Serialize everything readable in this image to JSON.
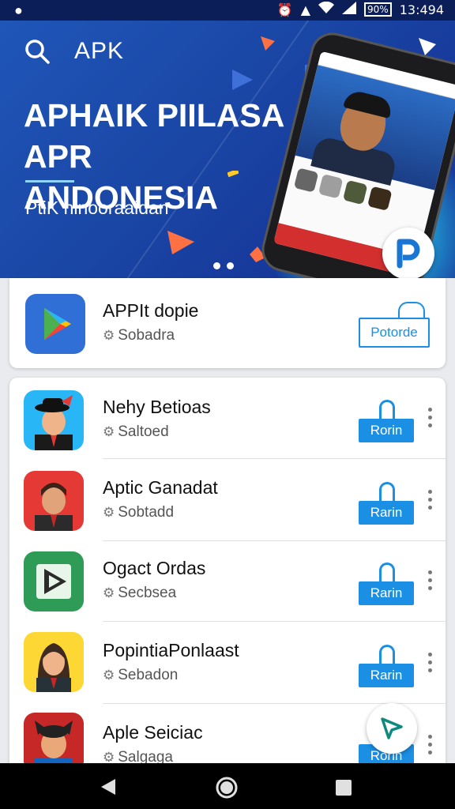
{
  "statusbar": {
    "time": "13:494",
    "battery": "90%"
  },
  "header": {
    "app_label": "APK"
  },
  "hero": {
    "title_line1": "APHAIK PIILASA",
    "title_line2": "APR ANDONESIA",
    "subtitle": "PtiK hinooraaidan"
  },
  "featured": {
    "name": "APPIt dopie",
    "sub": "Sobadra",
    "button": "Potorde"
  },
  "apps": [
    {
      "name": "Nehy Betioas",
      "sub": "Saltoed",
      "button": "Rorin"
    },
    {
      "name": "Aptic Ganadat",
      "sub": "Sobtadd",
      "button": "Rarin"
    },
    {
      "name": "Ogact Ordas",
      "sub": "Secbsea",
      "button": "Rarin"
    },
    {
      "name": "PopintiaPonlaast",
      "sub": "Sebadon",
      "button": "Rarin"
    },
    {
      "name": "Aple Seiciac",
      "sub": "Salgaga",
      "button": "Rorin"
    }
  ],
  "colors": {
    "accent": "#1a8fe3",
    "hero": "#1a46a5",
    "statusbar": "#0b1e58"
  },
  "icons": [
    "search-icon",
    "play-store-icon",
    "gear-icon",
    "more-vert-icon",
    "send-icon",
    "back-icon",
    "home-icon",
    "recents-icon"
  ]
}
